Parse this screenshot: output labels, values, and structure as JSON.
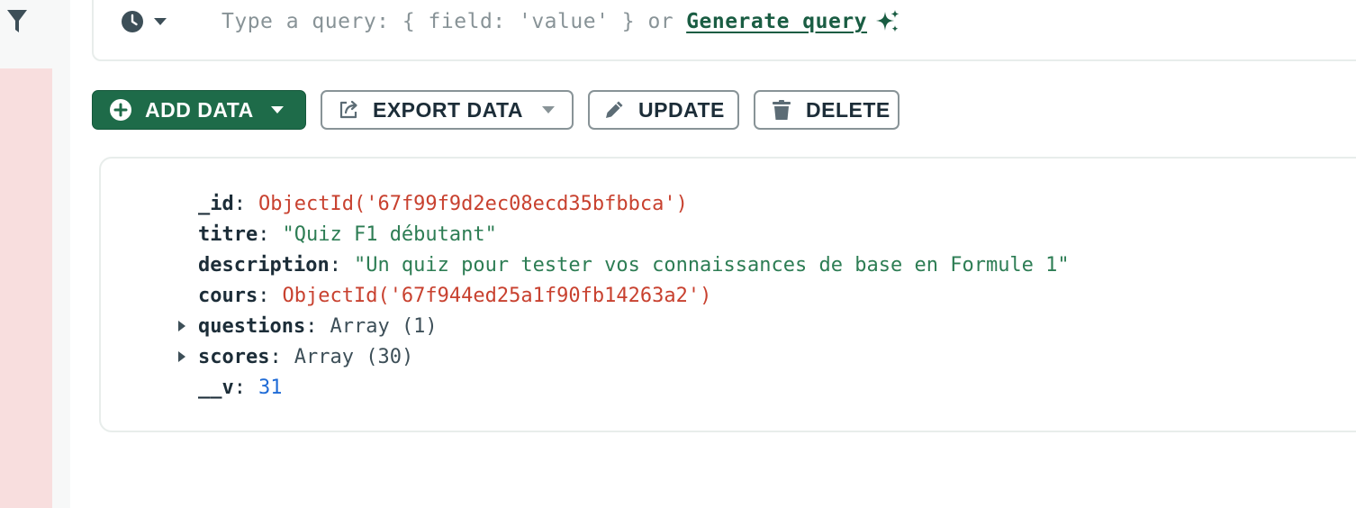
{
  "left_rail": {
    "filter_icon": "filter-icon"
  },
  "query_bar": {
    "history_icon": "clock-icon",
    "placeholder": "Type a query: { field: 'value' } or",
    "generate_label": "Generate query",
    "generate_icon": "sparkle-icon"
  },
  "toolbar": {
    "add_label": "ADD DATA",
    "export_label": "EXPORT DATA",
    "update_label": "UPDATE",
    "delete_label": "DELETE"
  },
  "document": {
    "fields": [
      {
        "key": "_id",
        "sep": ":",
        "value": "ObjectId('67f99f9d2ec08ecd35bfbbca')",
        "type": "objectid",
        "expandable": false
      },
      {
        "key": "titre",
        "sep": " :",
        "value": "\"Quiz F1 débutant\"",
        "type": "string",
        "expandable": false
      },
      {
        "key": "description",
        "sep": " :",
        "value": "\"Un quiz pour tester vos connaissances de base en Formule 1\"",
        "type": "string",
        "expandable": false
      },
      {
        "key": "cours",
        "sep": " :",
        "value": "ObjectId('67f944ed25a1f90fb14263a2')",
        "type": "objectid",
        "expandable": false
      },
      {
        "key": "questions",
        "sep": " :",
        "value": "Array (1)",
        "type": "array",
        "expandable": true
      },
      {
        "key": "scores",
        "sep": " :",
        "value": "Array (30)",
        "type": "array",
        "expandable": true
      },
      {
        "key": "__v",
        "sep": " :",
        "value": "31",
        "type": "number",
        "expandable": false
      }
    ]
  },
  "colors": {
    "brand_green": "#1e6b49",
    "objectid": "#c8412f",
    "string": "#2d7d54",
    "number": "#1f6bd6",
    "sidebar_pink": "#f8dede"
  }
}
